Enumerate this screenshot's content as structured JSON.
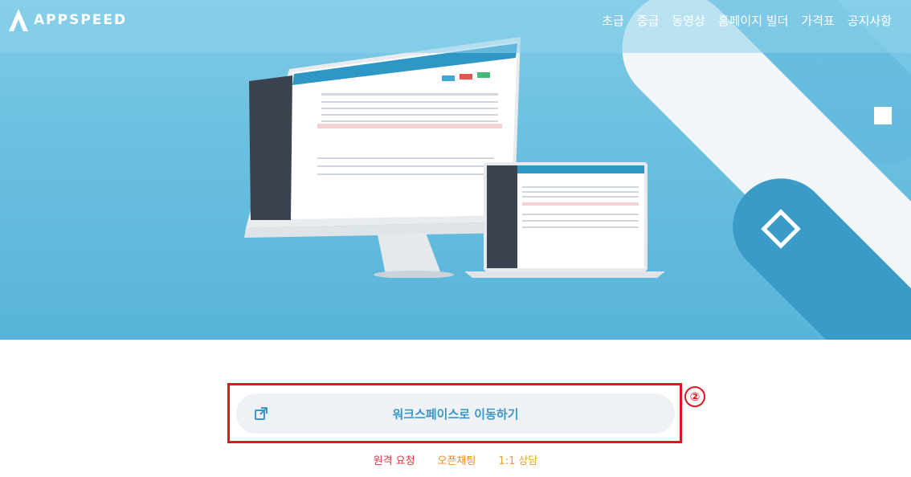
{
  "brand": {
    "name": "APPSPEED",
    "icon": "appspeed-logo-icon"
  },
  "nav": {
    "items": [
      "초급",
      "중급",
      "동영상",
      "홈페이지 빌더",
      "가격표",
      "공지사항"
    ]
  },
  "annotation": {
    "number": "②",
    "color": "#e0161e"
  },
  "workspace_button": {
    "label": "워크스페이스로 이동하기",
    "icon": "external-link-icon",
    "color": "#3a98c8"
  },
  "links": [
    {
      "label": "원격 요청",
      "color": "#d9383f"
    },
    {
      "label": "오픈채팅",
      "color": "#f08a1e"
    },
    {
      "label": "1:1 상담",
      "color": "#e8a21c"
    }
  ],
  "colors": {
    "hero_top": "#7fcbe6",
    "hero_bottom": "#58b4da",
    "accent": "#3a98c8"
  }
}
